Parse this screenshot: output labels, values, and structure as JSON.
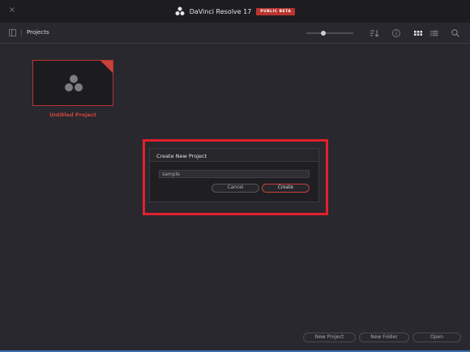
{
  "window": {
    "title": "DaVinci Resolve 17",
    "badge": "PUBLIC BETA",
    "close_glyph": "×"
  },
  "toolbar": {
    "section_label": "Projects",
    "zoom_level": 0.35,
    "icons": [
      "sidebar-toggle-icon",
      "sort-icon",
      "info-icon",
      "grid-view-icon",
      "list-view-icon",
      "search-icon"
    ]
  },
  "projects": [
    {
      "name": "Untitled Project"
    }
  ],
  "dialog": {
    "title": "Create New Project",
    "input_value": "sample",
    "cancel_label": "Cancel",
    "create_label": "Create"
  },
  "footer": {
    "new_project_label": "New Project",
    "new_folder_label": "New Folder",
    "open_label": "Open"
  },
  "colors": {
    "accent": "#c8413a",
    "highlight": "#e3202d",
    "background": "#28282e",
    "titlebar": "#1d1d21"
  }
}
